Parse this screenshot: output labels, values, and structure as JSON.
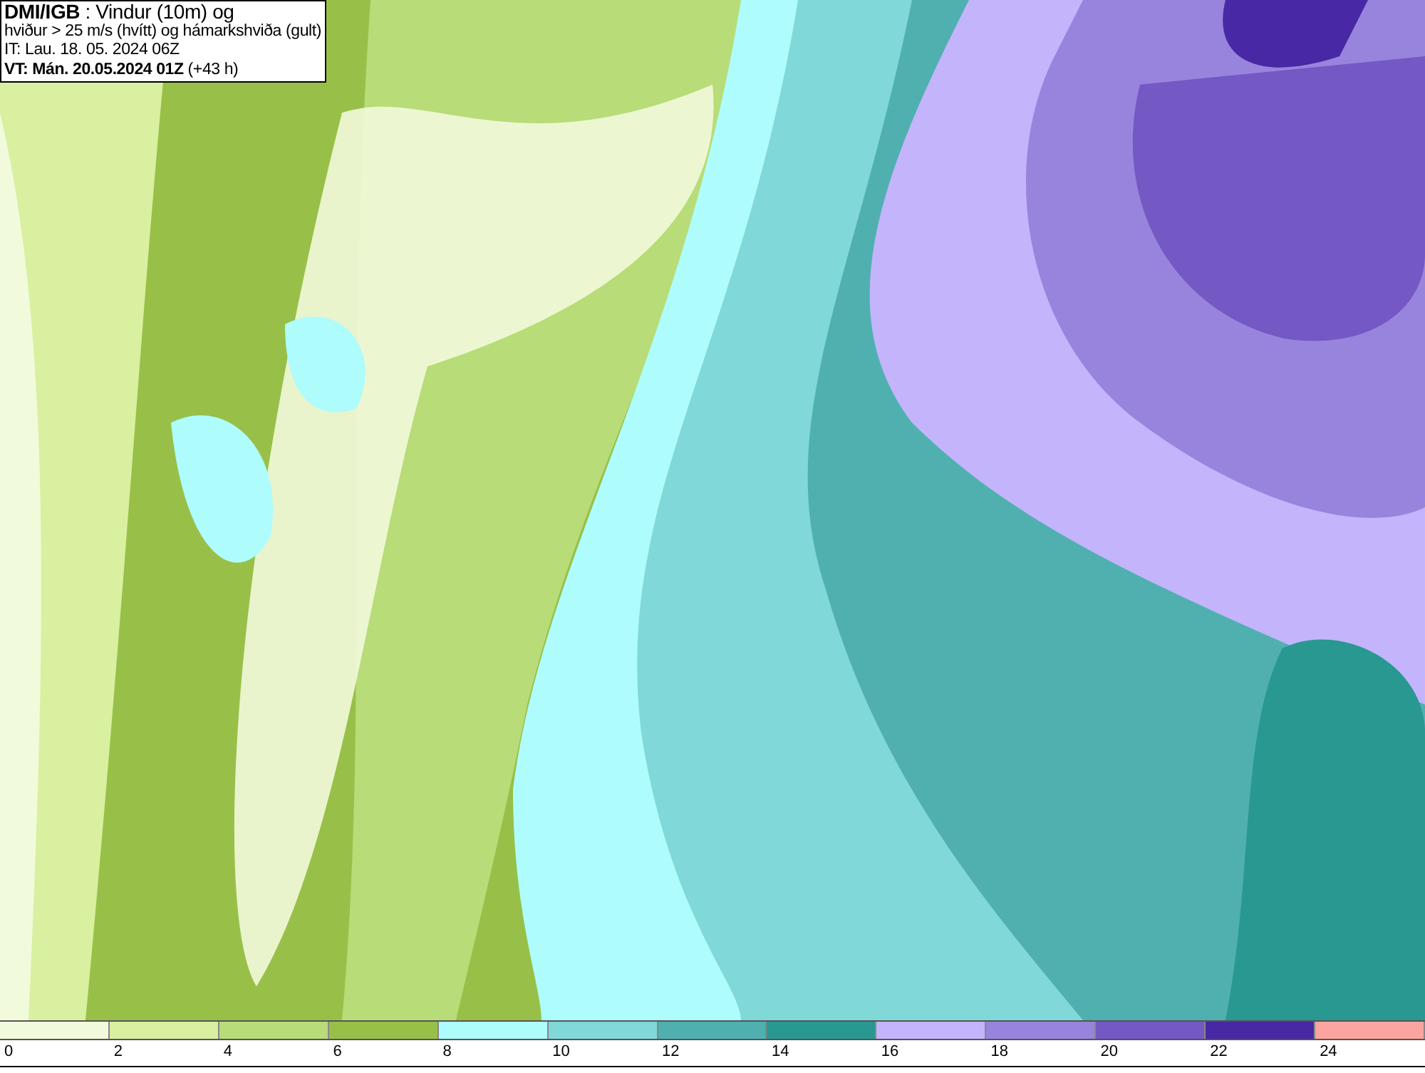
{
  "title_box": {
    "lines": [
      "**DMI/IGB** : Vindur (10m) og",
      "hviður > 25 m/s (hvítt) og hámarkshviða (gult)",
      "IT: Lau. 18. 05. 2024 06Z",
      "**VT: Mán. 20.05.2024 01Z** (+43 h)"
    ]
  },
  "legend": {
    "swatches": [
      {
        "color": "#f2fadc"
      },
      {
        "color": "#d8f0a0"
      },
      {
        "color": "#b8dc78"
      },
      {
        "color": "#98c048"
      },
      {
        "color": "#aefcfc"
      },
      {
        "color": "#80d8d8"
      },
      {
        "color": "#50b0b0"
      },
      {
        "color": "#289890"
      },
      {
        "color": "#c4b4fc"
      },
      {
        "color": "#9884dc"
      },
      {
        "color": "#7458c4"
      },
      {
        "color": "#4828a4"
      },
      {
        "color": "#fca4a0"
      }
    ],
    "labels": [
      "0",
      "2",
      "4",
      "6",
      "8",
      "10",
      "12",
      "14",
      "16",
      "18",
      "20",
      "22",
      "24"
    ]
  }
}
